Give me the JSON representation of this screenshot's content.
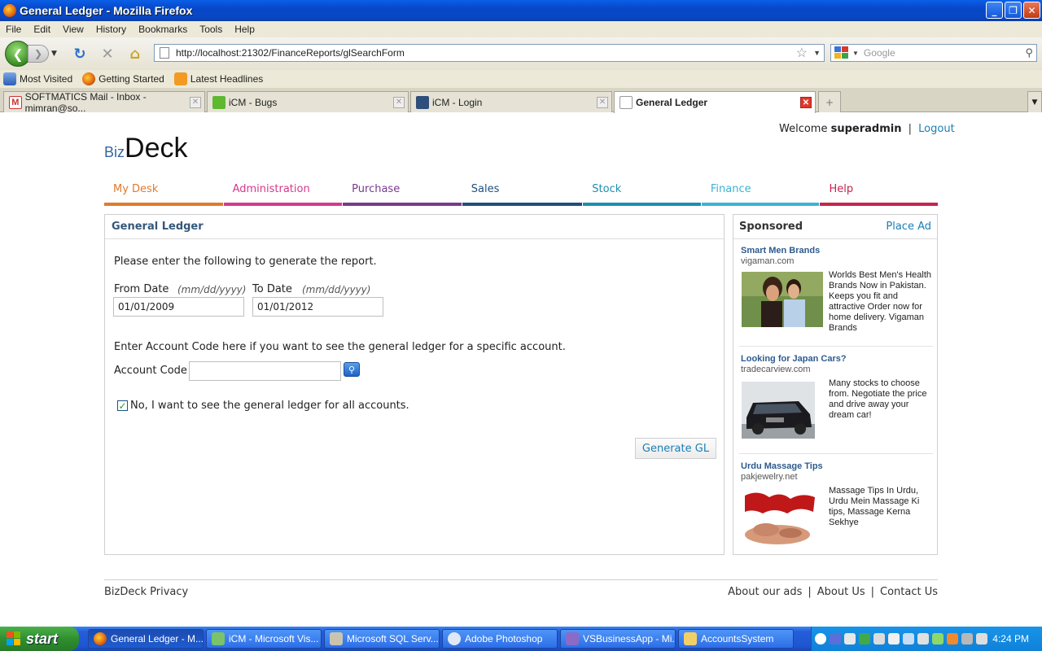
{
  "window": {
    "title": "General Ledger - Mozilla Firefox"
  },
  "menu": [
    "File",
    "Edit",
    "View",
    "History",
    "Bookmarks",
    "Tools",
    "Help"
  ],
  "address": {
    "url": "http://localhost:21302/FinanceReports/glSearchForm"
  },
  "search": {
    "placeholder": "Google"
  },
  "bookmarks": [
    "Most Visited",
    "Getting Started",
    "Latest Headlines"
  ],
  "tabs": [
    {
      "label": "SOFTMATICS Mail - Inbox - mimran@so..."
    },
    {
      "label": "iCM - Bugs"
    },
    {
      "label": "iCM - Login"
    },
    {
      "label": "General Ledger"
    }
  ],
  "header": {
    "welcome_prefix": "Welcome",
    "username": "superadmin",
    "separator": "|",
    "logout": "Logout",
    "logo_small": "Biz",
    "logo_large": "Deck"
  },
  "nav": [
    {
      "label": "My Desk",
      "color": "#e07a2c"
    },
    {
      "label": "Administration",
      "color": "#d6398a"
    },
    {
      "label": "Purchase",
      "color": "#7a3a8e"
    },
    {
      "label": "Sales",
      "color": "#1f4f7e"
    },
    {
      "label": "Stock",
      "color": "#1c8fae"
    },
    {
      "label": "Finance",
      "color": "#3bb3d4"
    },
    {
      "label": "Help",
      "color": "#c8234f"
    }
  ],
  "panel": {
    "title": "General Ledger",
    "intro": "Please enter the following to generate the report.",
    "from_label": "From Date",
    "from_hint": "(mm/dd/yyyy)",
    "from_value": "01/01/2009",
    "to_label": "To Date",
    "to_hint": "(mm/dd/yyyy)",
    "to_value": "01/01/2012",
    "account_note": "Enter Account Code here if you want to see the general ledger for a specific account.",
    "account_label": "Account Code",
    "account_value": "",
    "all_accounts_label": "No, I want to see the general ledger for all accounts.",
    "all_accounts_checked": true,
    "generate_label": "Generate GL"
  },
  "sponsored": {
    "title": "Sponsored",
    "place_ad": "Place Ad",
    "ads": [
      {
        "title": "Smart Men Brands",
        "domain": "vigaman.com",
        "text": "Worlds Best Men's Health Brands Now in Pakistan. Keeps you fit and attractive Order now for home delivery. Vigaman Brands"
      },
      {
        "title": "Looking for Japan Cars?",
        "domain": "tradecarview.com",
        "text": "Many stocks to choose from. Negotiate the price and drive away your dream car!"
      },
      {
        "title": "Urdu Massage Tips",
        "domain": "pakjewelry.net",
        "text": "Massage Tips In Urdu, Urdu Mein Massage Ki tips, Massage Kerna Sekhye"
      }
    ]
  },
  "footer": {
    "left": "BizDeck Privacy",
    "links": [
      "About our ads",
      "About Us",
      "Contact Us"
    ],
    "sep": "|"
  },
  "taskbar": {
    "start": "start",
    "items": [
      "General Ledger - M...",
      "iCM - Microsoft Vis...",
      "Microsoft SQL Serv...",
      "Adobe Photoshop",
      "VSBusinessApp - Mi...",
      "AccountsSystem"
    ],
    "clock": "4:24 PM"
  }
}
